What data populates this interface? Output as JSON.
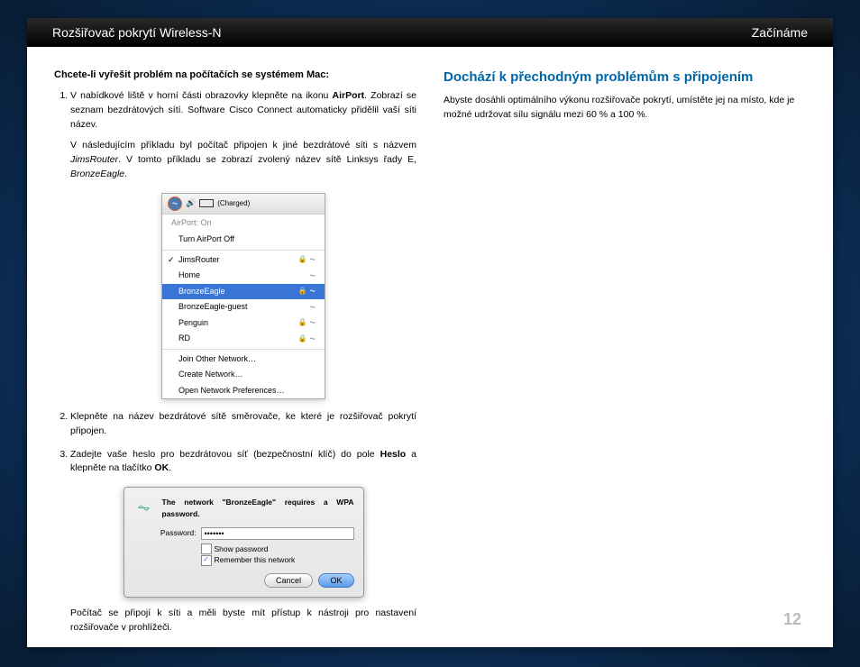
{
  "header": {
    "left": "Rozšiřovač pokrytí Wireless-N",
    "right": "Začínáme"
  },
  "left": {
    "title": "Chcete-li vyřešit problém na počítačích se systémem Mac:",
    "step1_a": "V nabídkové liště v horní části obrazovky klepněte na ikonu ",
    "step1_b": "AirPort",
    "step1_c": ". Zobrazí se seznam bezdrátových sítí. Software Cisco Connect automaticky přidělil vaší síti název.",
    "step1_para_a": "V následujícím příkladu byl počítač připojen k jiné bezdrátové síti s názvem ",
    "step1_para_b": "JimsRouter",
    "step1_para_c": ". V tomto příkladu se zobrazí zvolený název sítě Linksys řady E, ",
    "step1_para_d": "BronzeEagle",
    "step1_para_e": ".",
    "step2": "Klepněte na název bezdrátové sítě směrovače, ke které je rozšiřovač pokrytí připojen.",
    "step3_a": "Zadejte vaše heslo pro bezdrátovou síť (bezpečnostní klíč) do pole ",
    "step3_b": "Heslo",
    "step3_c": " a klepněte na tlačítko ",
    "step3_d": "OK",
    "step3_e": ".",
    "final_para": "Počítač se připojí k síti a měli byste mít přístup k nástroji pro nastavení rozšiřovače v prohlížeči."
  },
  "right": {
    "title": "Dochází k přechodným problémům s připojením",
    "para": "Abyste dosáhli optimálního výkonu rozšiřovače pokrytí, umístěte jej na místo, kde je možné udržovat sílu signálu mezi 60 % a 100 %."
  },
  "airport_menu": {
    "header_status": "(Charged)",
    "airport_on": "AirPort: On",
    "turn_off": "Turn AirPort Off",
    "networks": [
      {
        "name": "JimsRouter",
        "checked": true,
        "lock": true
      },
      {
        "name": "Home",
        "checked": false,
        "lock": false
      },
      {
        "name": "BronzeEagle",
        "checked": false,
        "lock": true,
        "selected": true
      },
      {
        "name": "BronzeEagle-guest",
        "checked": false,
        "lock": false
      },
      {
        "name": "Penguin",
        "checked": false,
        "lock": true
      },
      {
        "name": "RD",
        "checked": false,
        "lock": true
      }
    ],
    "join_other": "Join Other Network…",
    "create": "Create Network…",
    "open_prefs": "Open Network Preferences…"
  },
  "password_dialog": {
    "message": "The network \"BronzeEagle\" requires a WPA password.",
    "password_label": "Password:",
    "password_value": "•••••••",
    "show_password": "Show password",
    "remember": "Remember this network",
    "cancel": "Cancel",
    "ok": "OK"
  },
  "page_number": "12"
}
